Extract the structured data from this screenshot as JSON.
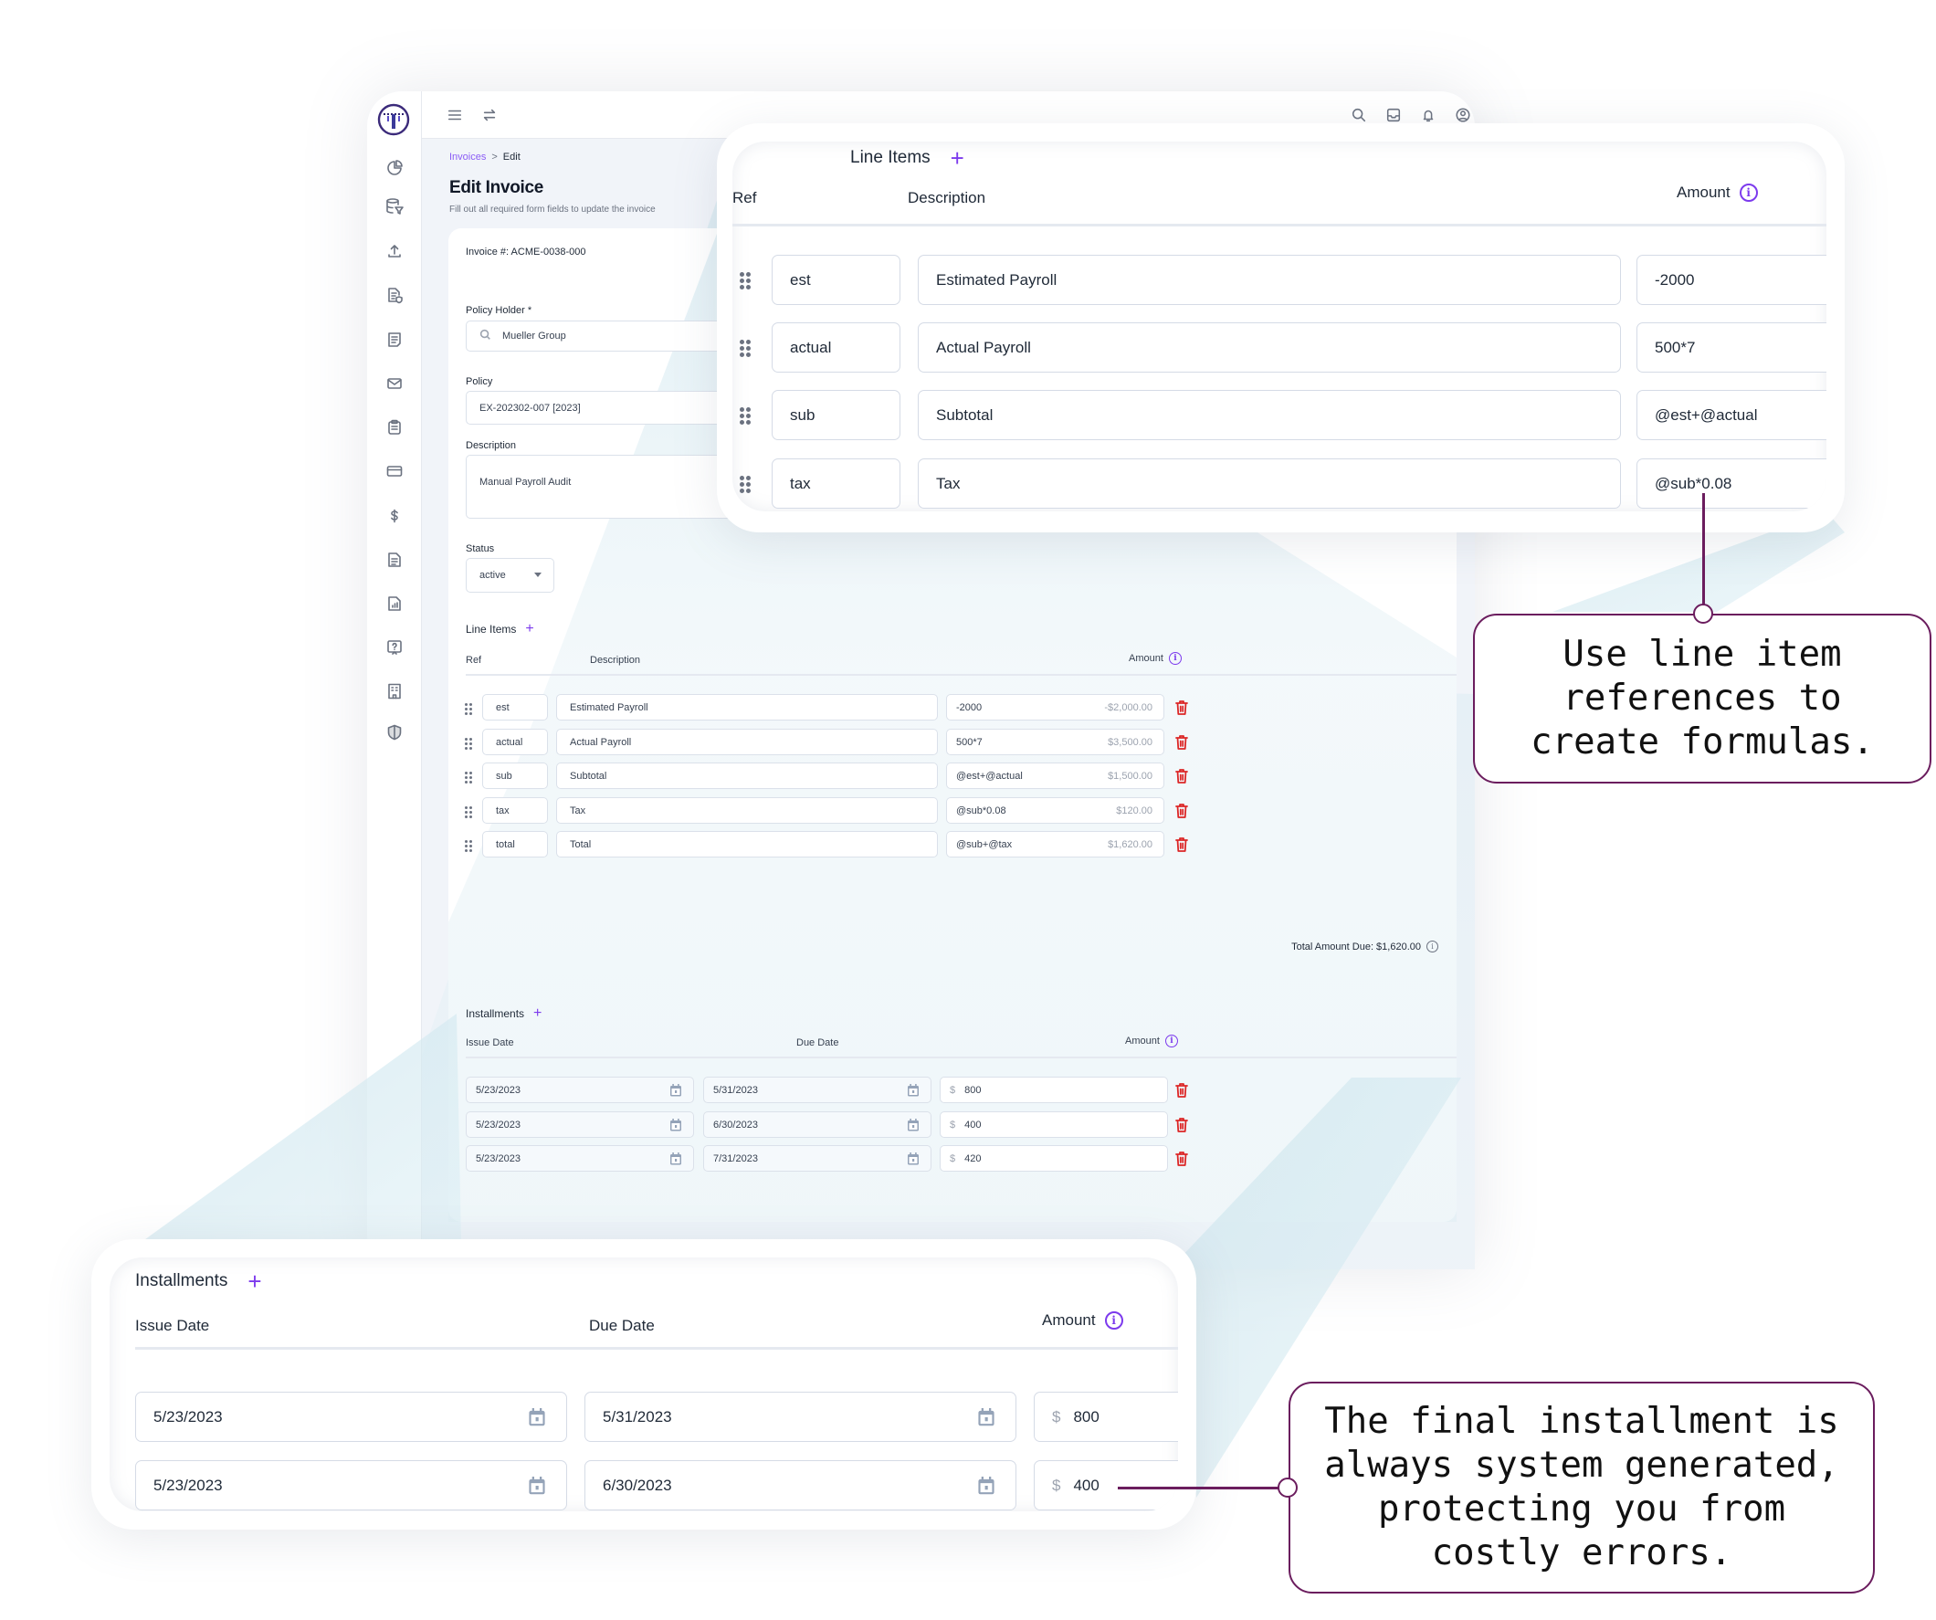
{
  "app": {
    "sidebar": {
      "items": [
        {
          "icon": "logo-icon"
        },
        {
          "icon": "dashboard-pie-icon"
        },
        {
          "icon": "database-filter-icon"
        },
        {
          "icon": "upload-icon"
        },
        {
          "icon": "document-shield-icon"
        },
        {
          "icon": "document-data-icon"
        },
        {
          "icon": "mail-icon"
        },
        {
          "icon": "clipboard-list-icon"
        },
        {
          "icon": "credit-card-icon"
        },
        {
          "icon": "dollar-icon"
        },
        {
          "icon": "document-icon"
        },
        {
          "icon": "report-icon"
        },
        {
          "icon": "help-icon"
        },
        {
          "icon": "building-icon"
        },
        {
          "icon": "shield-icon"
        }
      ]
    },
    "topbar": {
      "left_icons": [
        "menu-icon",
        "swap-icon"
      ],
      "right_icons": [
        "search-icon",
        "inbox-icon",
        "bell-icon",
        "user-icon"
      ]
    },
    "breadcrumb": {
      "parent": "Invoices",
      "separator": ">",
      "current": "Edit"
    },
    "title": "Edit Invoice",
    "subtitle": "Fill out all required form fields to update the invoice",
    "form": {
      "invoice_number": "Invoice #: ACME-0038-000",
      "policy_holder": {
        "label": "Policy Holder *",
        "value": "Mueller Group"
      },
      "policy": {
        "label": "Policy",
        "value": "EX-202302-007 [2023]"
      },
      "description": {
        "label": "Description",
        "value": "Manual Payroll Audit"
      },
      "status": {
        "label": "Status",
        "value": "active"
      }
    },
    "line_items": {
      "title": "Line Items",
      "headers": {
        "ref": "Ref",
        "description": "Description",
        "amount": "Amount"
      },
      "rows": [
        {
          "ref": "est",
          "description": "Estimated Payroll",
          "amount": "-2000",
          "computed": "-$2,000.00"
        },
        {
          "ref": "actual",
          "description": "Actual Payroll",
          "amount": "500*7",
          "computed": "$3,500.00"
        },
        {
          "ref": "sub",
          "description": "Subtotal",
          "amount": "@est+@actual",
          "computed": "$1,500.00"
        },
        {
          "ref": "tax",
          "description": "Tax",
          "amount": "@sub*0.08",
          "computed": "$120.00"
        },
        {
          "ref": "total",
          "description": "Total",
          "amount": "@sub+@tax",
          "computed": "$1,620.00"
        }
      ],
      "total_due": "Total Amount Due: $1,620.00"
    },
    "installments": {
      "title": "Installments",
      "headers": {
        "issue_date": "Issue Date",
        "due_date": "Due Date",
        "amount": "Amount"
      },
      "currency_symbol": "$",
      "rows": [
        {
          "issue_date": "5/23/2023",
          "due_date": "5/31/2023",
          "amount": "800"
        },
        {
          "issue_date": "5/23/2023",
          "due_date": "6/30/2023",
          "amount": "400"
        },
        {
          "issue_date": "5/23/2023",
          "due_date": "7/31/2023",
          "amount": "420"
        }
      ]
    }
  },
  "zoom_line_items": {
    "title": "Line Items",
    "headers": {
      "ref": "Ref",
      "description": "Description",
      "amount": "Amount"
    },
    "rows": [
      {
        "ref": "est",
        "description": "Estimated Payroll",
        "amount": "-2000"
      },
      {
        "ref": "actual",
        "description": "Actual Payroll",
        "amount": "500*7"
      },
      {
        "ref": "sub",
        "description": "Subtotal",
        "amount": "@est+@actual"
      },
      {
        "ref": "tax",
        "description": "Tax",
        "amount": "@sub*0.08"
      }
    ]
  },
  "zoom_installments": {
    "title": "Installments",
    "headers": {
      "issue_date": "Issue Date",
      "due_date": "Due Date",
      "amount": "Amount"
    },
    "currency_symbol": "$",
    "rows": [
      {
        "issue_date": "5/23/2023",
        "due_date": "5/31/2023",
        "amount": "800"
      },
      {
        "issue_date": "5/23/2023",
        "due_date": "6/30/2023",
        "amount": "400"
      }
    ]
  },
  "callouts": {
    "formulas": [
      "Use line item",
      "references to",
      "create formulas."
    ],
    "installments": [
      "The final installment is",
      "always system generated,",
      "protecting you from",
      "costly errors."
    ]
  },
  "colors": {
    "accent": "#7c3aed",
    "breadcrumb_link": "#8b5cf6",
    "delete": "#dc2626",
    "callout_border": "#6b1d5e",
    "beam": "#cfe6ee"
  }
}
